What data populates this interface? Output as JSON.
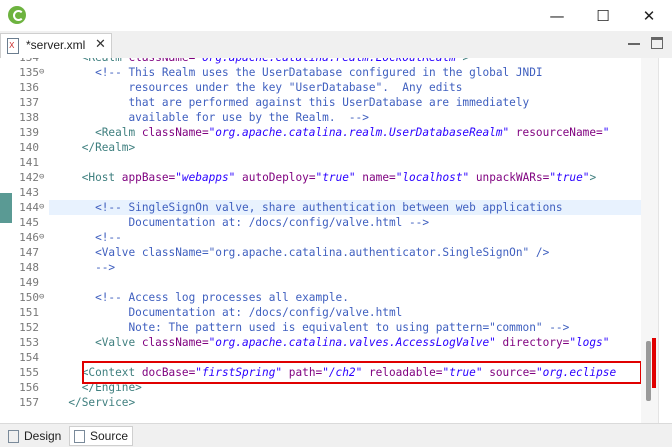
{
  "window": {
    "minimize_glyph": "—",
    "maximize_glyph": "☐",
    "close_glyph": "✕",
    "icon": "spring-leaf-icon"
  },
  "editor_tab": {
    "label": "*server.xml",
    "close_glyph": "✕"
  },
  "colors": {
    "tag": "#3f7f7f",
    "attribute": "#7f007f",
    "value": "#2a00ff",
    "comment": "#3f5fbf",
    "highlight_box": "#e00000",
    "current_line": "#e8f2fe"
  },
  "lines": [
    {
      "num": "134",
      "fold": "",
      "highlight": false,
      "segments": [
        {
          "t": "tag",
          "s": "    <Realm "
        },
        {
          "t": "attr",
          "s": "className="
        },
        {
          "t": "val",
          "s": "\"org.apache.catalina.realm.LockOutRealm\""
        },
        {
          "t": "tag",
          "s": ">"
        }
      ]
    },
    {
      "num": "135",
      "fold": "⊖",
      "highlight": false,
      "segments": [
        {
          "t": "com",
          "s": "      <!-- This Realm uses the UserDatabase configured in the global JNDI"
        }
      ]
    },
    {
      "num": "136",
      "fold": "",
      "highlight": false,
      "segments": [
        {
          "t": "com",
          "s": "           resources under the key \"UserDatabase\".  Any edits"
        }
      ]
    },
    {
      "num": "137",
      "fold": "",
      "highlight": false,
      "segments": [
        {
          "t": "com",
          "s": "           that are performed against this UserDatabase are immediately"
        }
      ]
    },
    {
      "num": "138",
      "fold": "",
      "highlight": false,
      "segments": [
        {
          "t": "com",
          "s": "           available for use by the Realm.  -->"
        }
      ]
    },
    {
      "num": "139",
      "fold": "",
      "highlight": false,
      "segments": [
        {
          "t": "tag",
          "s": "      <Realm "
        },
        {
          "t": "attr",
          "s": "className="
        },
        {
          "t": "val",
          "s": "\"org.apache.catalina.realm.UserDatabaseRealm\""
        },
        {
          "t": "plain",
          "s": " "
        },
        {
          "t": "attr",
          "s": "resourceName="
        },
        {
          "t": "val",
          "s": "\""
        }
      ]
    },
    {
      "num": "140",
      "fold": "",
      "highlight": false,
      "segments": [
        {
          "t": "tag",
          "s": "    </Realm>"
        }
      ]
    },
    {
      "num": "141",
      "fold": "",
      "highlight": false,
      "segments": []
    },
    {
      "num": "142",
      "fold": "⊖",
      "highlight": false,
      "segments": [
        {
          "t": "tag",
          "s": "    <Host "
        },
        {
          "t": "attr",
          "s": "appBase="
        },
        {
          "t": "val",
          "s": "\"webapps\""
        },
        {
          "t": "plain",
          "s": " "
        },
        {
          "t": "attr",
          "s": "autoDeploy="
        },
        {
          "t": "val",
          "s": "\"true\""
        },
        {
          "t": "plain",
          "s": " "
        },
        {
          "t": "attr",
          "s": "name="
        },
        {
          "t": "val",
          "s": "\"localhost\""
        },
        {
          "t": "plain",
          "s": " "
        },
        {
          "t": "attr",
          "s": "unpackWARs="
        },
        {
          "t": "val",
          "s": "\"true\""
        },
        {
          "t": "tag",
          "s": ">"
        }
      ]
    },
    {
      "num": "143",
      "fold": "",
      "highlight": false,
      "segments": []
    },
    {
      "num": "144",
      "fold": "⊖",
      "highlight": true,
      "segments": [
        {
          "t": "com",
          "s": "      <!-- SingleSignOn valve, share authentication between web applications"
        }
      ]
    },
    {
      "num": "145",
      "fold": "",
      "highlight": false,
      "segments": [
        {
          "t": "com",
          "s": "           Documentation at: /docs/config/valve.html -->"
        }
      ]
    },
    {
      "num": "146",
      "fold": "⊖",
      "highlight": false,
      "segments": [
        {
          "t": "com",
          "s": "      <!--"
        }
      ]
    },
    {
      "num": "147",
      "fold": "",
      "highlight": false,
      "segments": [
        {
          "t": "com",
          "s": "      <Valve className=\"org.apache.catalina.authenticator.SingleSignOn\" />"
        }
      ]
    },
    {
      "num": "148",
      "fold": "",
      "highlight": false,
      "segments": [
        {
          "t": "com",
          "s": "      -->"
        }
      ]
    },
    {
      "num": "149",
      "fold": "",
      "highlight": false,
      "segments": []
    },
    {
      "num": "150",
      "fold": "⊖",
      "highlight": false,
      "segments": [
        {
          "t": "com",
          "s": "      <!-- Access log processes all example."
        }
      ]
    },
    {
      "num": "151",
      "fold": "",
      "highlight": false,
      "segments": [
        {
          "t": "com",
          "s": "           Documentation at: /docs/config/valve.html"
        }
      ]
    },
    {
      "num": "152",
      "fold": "",
      "highlight": false,
      "segments": [
        {
          "t": "com",
          "s": "           Note: The pattern used is equivalent to using pattern=\"common\" -->"
        }
      ]
    },
    {
      "num": "153",
      "fold": "",
      "highlight": false,
      "segments": [
        {
          "t": "tag",
          "s": "      <Valve "
        },
        {
          "t": "attr",
          "s": "className="
        },
        {
          "t": "val",
          "s": "\"org.apache.catalina.valves.AccessLogValve\""
        },
        {
          "t": "plain",
          "s": " "
        },
        {
          "t": "attr",
          "s": "directory="
        },
        {
          "t": "val",
          "s": "\"logs\""
        }
      ]
    },
    {
      "num": "154",
      "fold": "",
      "highlight": false,
      "segments": []
    },
    {
      "num": "155",
      "fold": "",
      "highlight": false,
      "segments": [
        {
          "t": "tag",
          "s": "    <Context "
        },
        {
          "t": "attr",
          "s": "docBase="
        },
        {
          "t": "val",
          "s": "\"firstSpring\""
        },
        {
          "t": "plain",
          "s": " "
        },
        {
          "t": "attr",
          "s": "path="
        },
        {
          "t": "val",
          "s": "\"/ch2\""
        },
        {
          "t": "plain",
          "s": " "
        },
        {
          "t": "attr",
          "s": "reloadable="
        },
        {
          "t": "val",
          "s": "\"true\""
        },
        {
          "t": "plain",
          "s": " "
        },
        {
          "t": "attr",
          "s": "source="
        },
        {
          "t": "val",
          "s": "\"org.eclipse"
        }
      ]
    },
    {
      "num": "156",
      "fold": "",
      "highlight": false,
      "segments": [
        {
          "t": "tag",
          "s": "    </Engine>"
        }
      ]
    },
    {
      "num": "157",
      "fold": "",
      "highlight": false,
      "segments": [
        {
          "t": "tag",
          "s": "  </Service>"
        }
      ]
    }
  ],
  "bottom_tabs": [
    {
      "label": "Design",
      "icon": "design-grid-icon",
      "active": false
    },
    {
      "label": "Source",
      "icon": "source-file-icon",
      "active": true
    }
  ]
}
